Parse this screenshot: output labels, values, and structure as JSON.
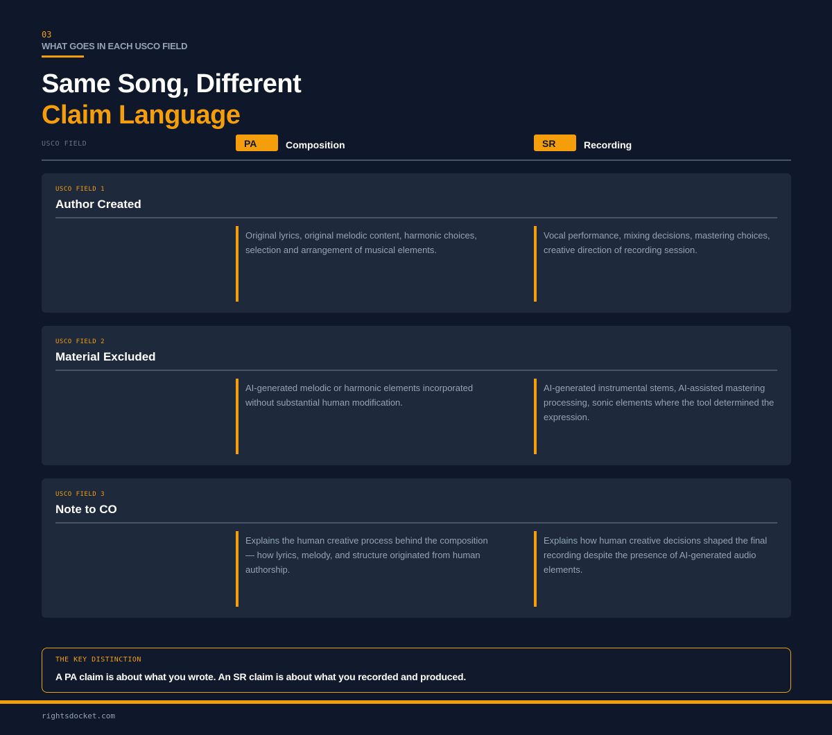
{
  "section": {
    "number": "03",
    "title": "WHAT GOES IN EACH USCO FIELD"
  },
  "heading": {
    "line1": "Same Song, Different",
    "line2": "Claim Language"
  },
  "columns": {
    "field_label": "USCO FIELD",
    "pa": {
      "badge": "PA",
      "name": "Composition"
    },
    "sr": {
      "badge": "SR",
      "name": "Recording"
    }
  },
  "rows": [
    {
      "kicker": "USCO FIELD 1",
      "title": "Author Created",
      "pa": "Original lyrics, original melodic content, harmonic choices, selection and arrangement of musical elements.",
      "sr": "Vocal performance, mixing decisions, mastering choices, creative direction of recording session."
    },
    {
      "kicker": "USCO FIELD 2",
      "title": "Material Excluded",
      "pa": "AI-generated melodic or harmonic elements incorporated without substantial human modification.",
      "sr": "AI-generated instrumental stems, AI-assisted mastering processing, sonic elements where the tool determined the expression."
    },
    {
      "kicker": "USCO FIELD 3",
      "title": "Note to CO",
      "pa": "Explains the human creative process behind the composition — how lyrics, melody, and structure originated from human authorship.",
      "sr": "Explains how human creative decisions shaped the final recording despite the presence of AI-generated audio elements."
    }
  ],
  "callout": {
    "kicker": "THE KEY DISTINCTION",
    "text": "A PA claim is about what you wrote.  An SR claim is about what you recorded and produced."
  },
  "footer": {
    "site": "rightsdocket.com"
  },
  "colors": {
    "background": "#0f172a",
    "card": "#1e293b",
    "accent": "#f59e0b",
    "muted": "#94a3b8"
  }
}
